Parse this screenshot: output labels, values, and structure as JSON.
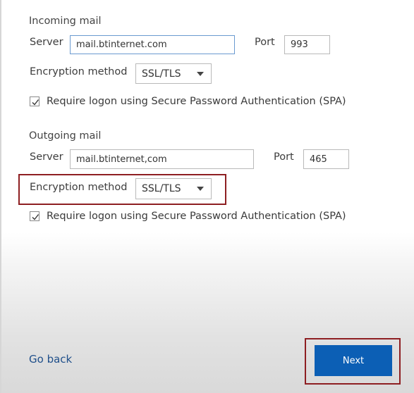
{
  "incoming": {
    "heading": "Incoming mail",
    "server_label": "Server",
    "server_value": "mail.btinternet.com",
    "port_label": "Port",
    "port_value": "993",
    "encryption_label": "Encryption method",
    "encryption_value": "SSL/TLS",
    "spa_label": "Require logon using Secure Password Authentication (SPA)",
    "spa_checked": true
  },
  "outgoing": {
    "heading": "Outgoing mail",
    "server_label": "Server",
    "server_value": "mail.btinternet,com",
    "port_label": "Port",
    "port_value": "465",
    "encryption_label": "Encryption method",
    "encryption_value": "SSL/TLS",
    "spa_label": "Require logon using Secure Password Authentication (SPA)",
    "spa_checked": true
  },
  "footer": {
    "back_label": "Go back",
    "next_label": "Next"
  },
  "colors": {
    "accent": "#0c5fb5",
    "link": "#1f4f8a",
    "highlight": "#8e1f22"
  }
}
